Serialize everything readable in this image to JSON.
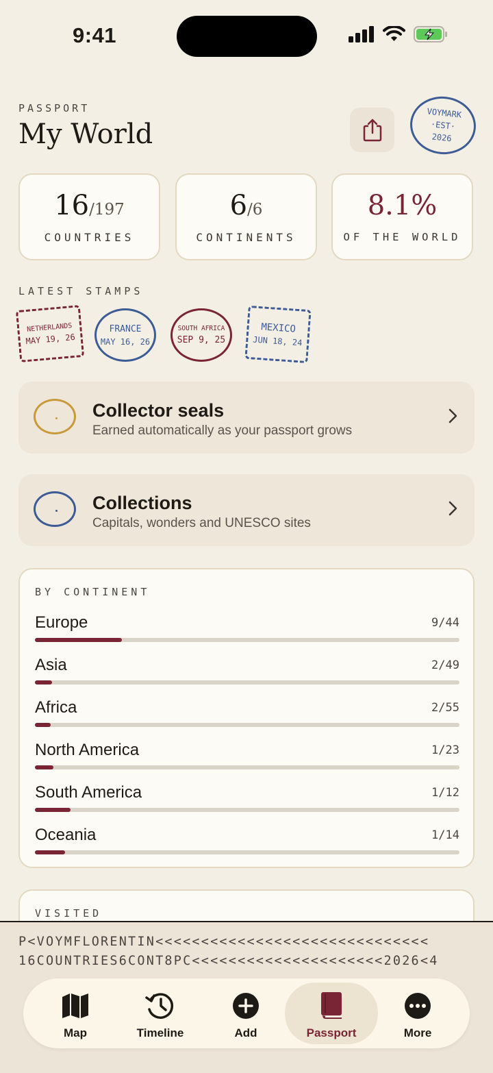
{
  "status": {
    "time": "9:41"
  },
  "header": {
    "eyebrow": "PASSPORT",
    "title": "My World",
    "logo_lines": [
      "VOYMARK",
      "·EST·",
      "2026"
    ]
  },
  "stats": [
    {
      "value": "16",
      "total": "/197",
      "label": "COUNTRIES"
    },
    {
      "value": "6",
      "total": "/6",
      "label": "CONTINENTS"
    },
    {
      "value": "8.1%",
      "total": "",
      "label": "OF THE WORLD"
    }
  ],
  "latest_stamps": {
    "heading": "LATEST STAMPS",
    "items": [
      {
        "country": "NETHERLANDS",
        "date": "MAY 19, 26",
        "color": "#7a2535",
        "style": "dashed-square"
      },
      {
        "country": "FRANCE",
        "date": "MAY 16, 26",
        "color": "#3d5b94",
        "style": "circle"
      },
      {
        "country": "SOUTH AFRICA",
        "date": "SEP 9, 25",
        "color": "#7a2535",
        "style": "circle"
      },
      {
        "country": "MEXICO",
        "date": "JUN 18, 24",
        "color": "#3d5b94",
        "style": "dashed-square"
      }
    ]
  },
  "rows": {
    "seals": {
      "title": "Collector seals",
      "subtitle": "Earned automatically as your passport grows",
      "ring_color": "#c99a3c"
    },
    "collections": {
      "title": "Collections",
      "subtitle": "Capitals, wonders and UNESCO sites",
      "ring_color": "#3d5b94"
    }
  },
  "by_continent": {
    "heading": "BY CONTINENT",
    "items": [
      {
        "name": "Europe",
        "count": "9/44",
        "progress": 0.2045
      },
      {
        "name": "Asia",
        "count": "2/49",
        "progress": 0.0408
      },
      {
        "name": "Africa",
        "count": "2/55",
        "progress": 0.0364
      },
      {
        "name": "North America",
        "count": "1/23",
        "progress": 0.0435
      },
      {
        "name": "South America",
        "count": "1/12",
        "progress": 0.0833
      },
      {
        "name": "Oceania",
        "count": "1/14",
        "progress": 0.0714
      }
    ]
  },
  "visited": {
    "heading": "VISITED"
  },
  "mrz": {
    "line1": "P<VOYMFLORENTIN<<<<<<<<<<<<<<<<<<<<<<<<<<<<<<",
    "line2": "16COUNTRIES6CONT8PC<<<<<<<<<<<<<<<<<<<<<2026<4"
  },
  "tabs": [
    {
      "label": "Map",
      "icon": "map-icon"
    },
    {
      "label": "Timeline",
      "icon": "history-icon"
    },
    {
      "label": "Add",
      "icon": "plus-circle-icon"
    },
    {
      "label": "Passport",
      "icon": "book-icon",
      "active": true
    },
    {
      "label": "More",
      "icon": "ellipsis-circle-icon"
    }
  ],
  "colors": {
    "accent": "#7a2535",
    "blue": "#3d5b94",
    "gold": "#c99a3c",
    "background": "#f3efe5"
  }
}
